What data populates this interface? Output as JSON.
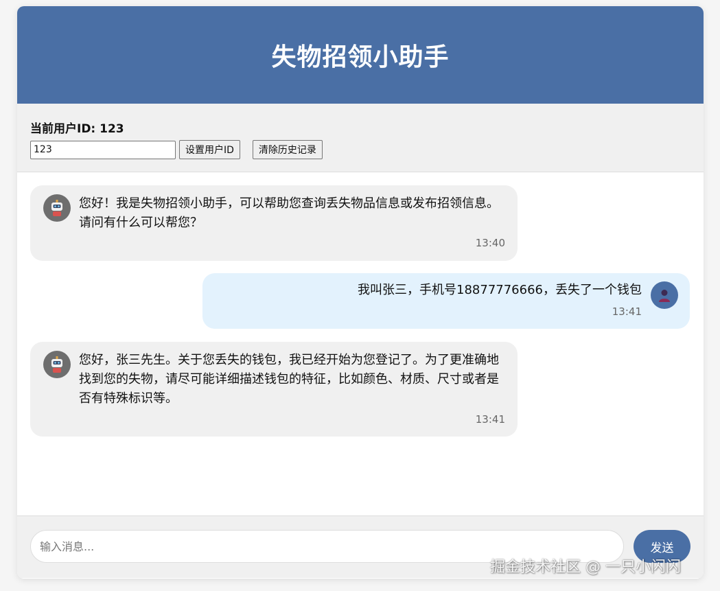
{
  "header": {
    "title": "失物招领小助手"
  },
  "user": {
    "current_id_label": "当前用户ID: 123",
    "id_input_value": "123",
    "set_id_button": "设置用户ID",
    "clear_history_button": "清除历史记录"
  },
  "messages": [
    {
      "sender": "bot",
      "avatar_icon": "robot-icon",
      "text": "您好！我是失物招领小助手，可以帮助您查询丢失物品信息或发布招领信息。请问有什么可以帮您？",
      "time": "13:40"
    },
    {
      "sender": "user",
      "avatar_icon": "user-icon",
      "text": "我叫张三，手机号18877776666，丢失了一个钱包",
      "time": "13:41"
    },
    {
      "sender": "bot",
      "avatar_icon": "robot-icon",
      "text": "您好，张三先生。关于您丢失的钱包，我已经开始为您登记了。为了更准确地找到您的失物，请尽可能详细描述钱包的特征，比如颜色、材质、尺寸或者是否有特殊标识等。",
      "time": "13:41"
    }
  ],
  "composer": {
    "placeholder": "输入消息...",
    "send_button": "发送"
  },
  "watermark": "掘金技术社区 @ 一只小闪闪",
  "colors": {
    "primary": "#4a6fa5",
    "bot_bubble": "#f0f0f0",
    "user_bubble": "#e3f2fd"
  }
}
